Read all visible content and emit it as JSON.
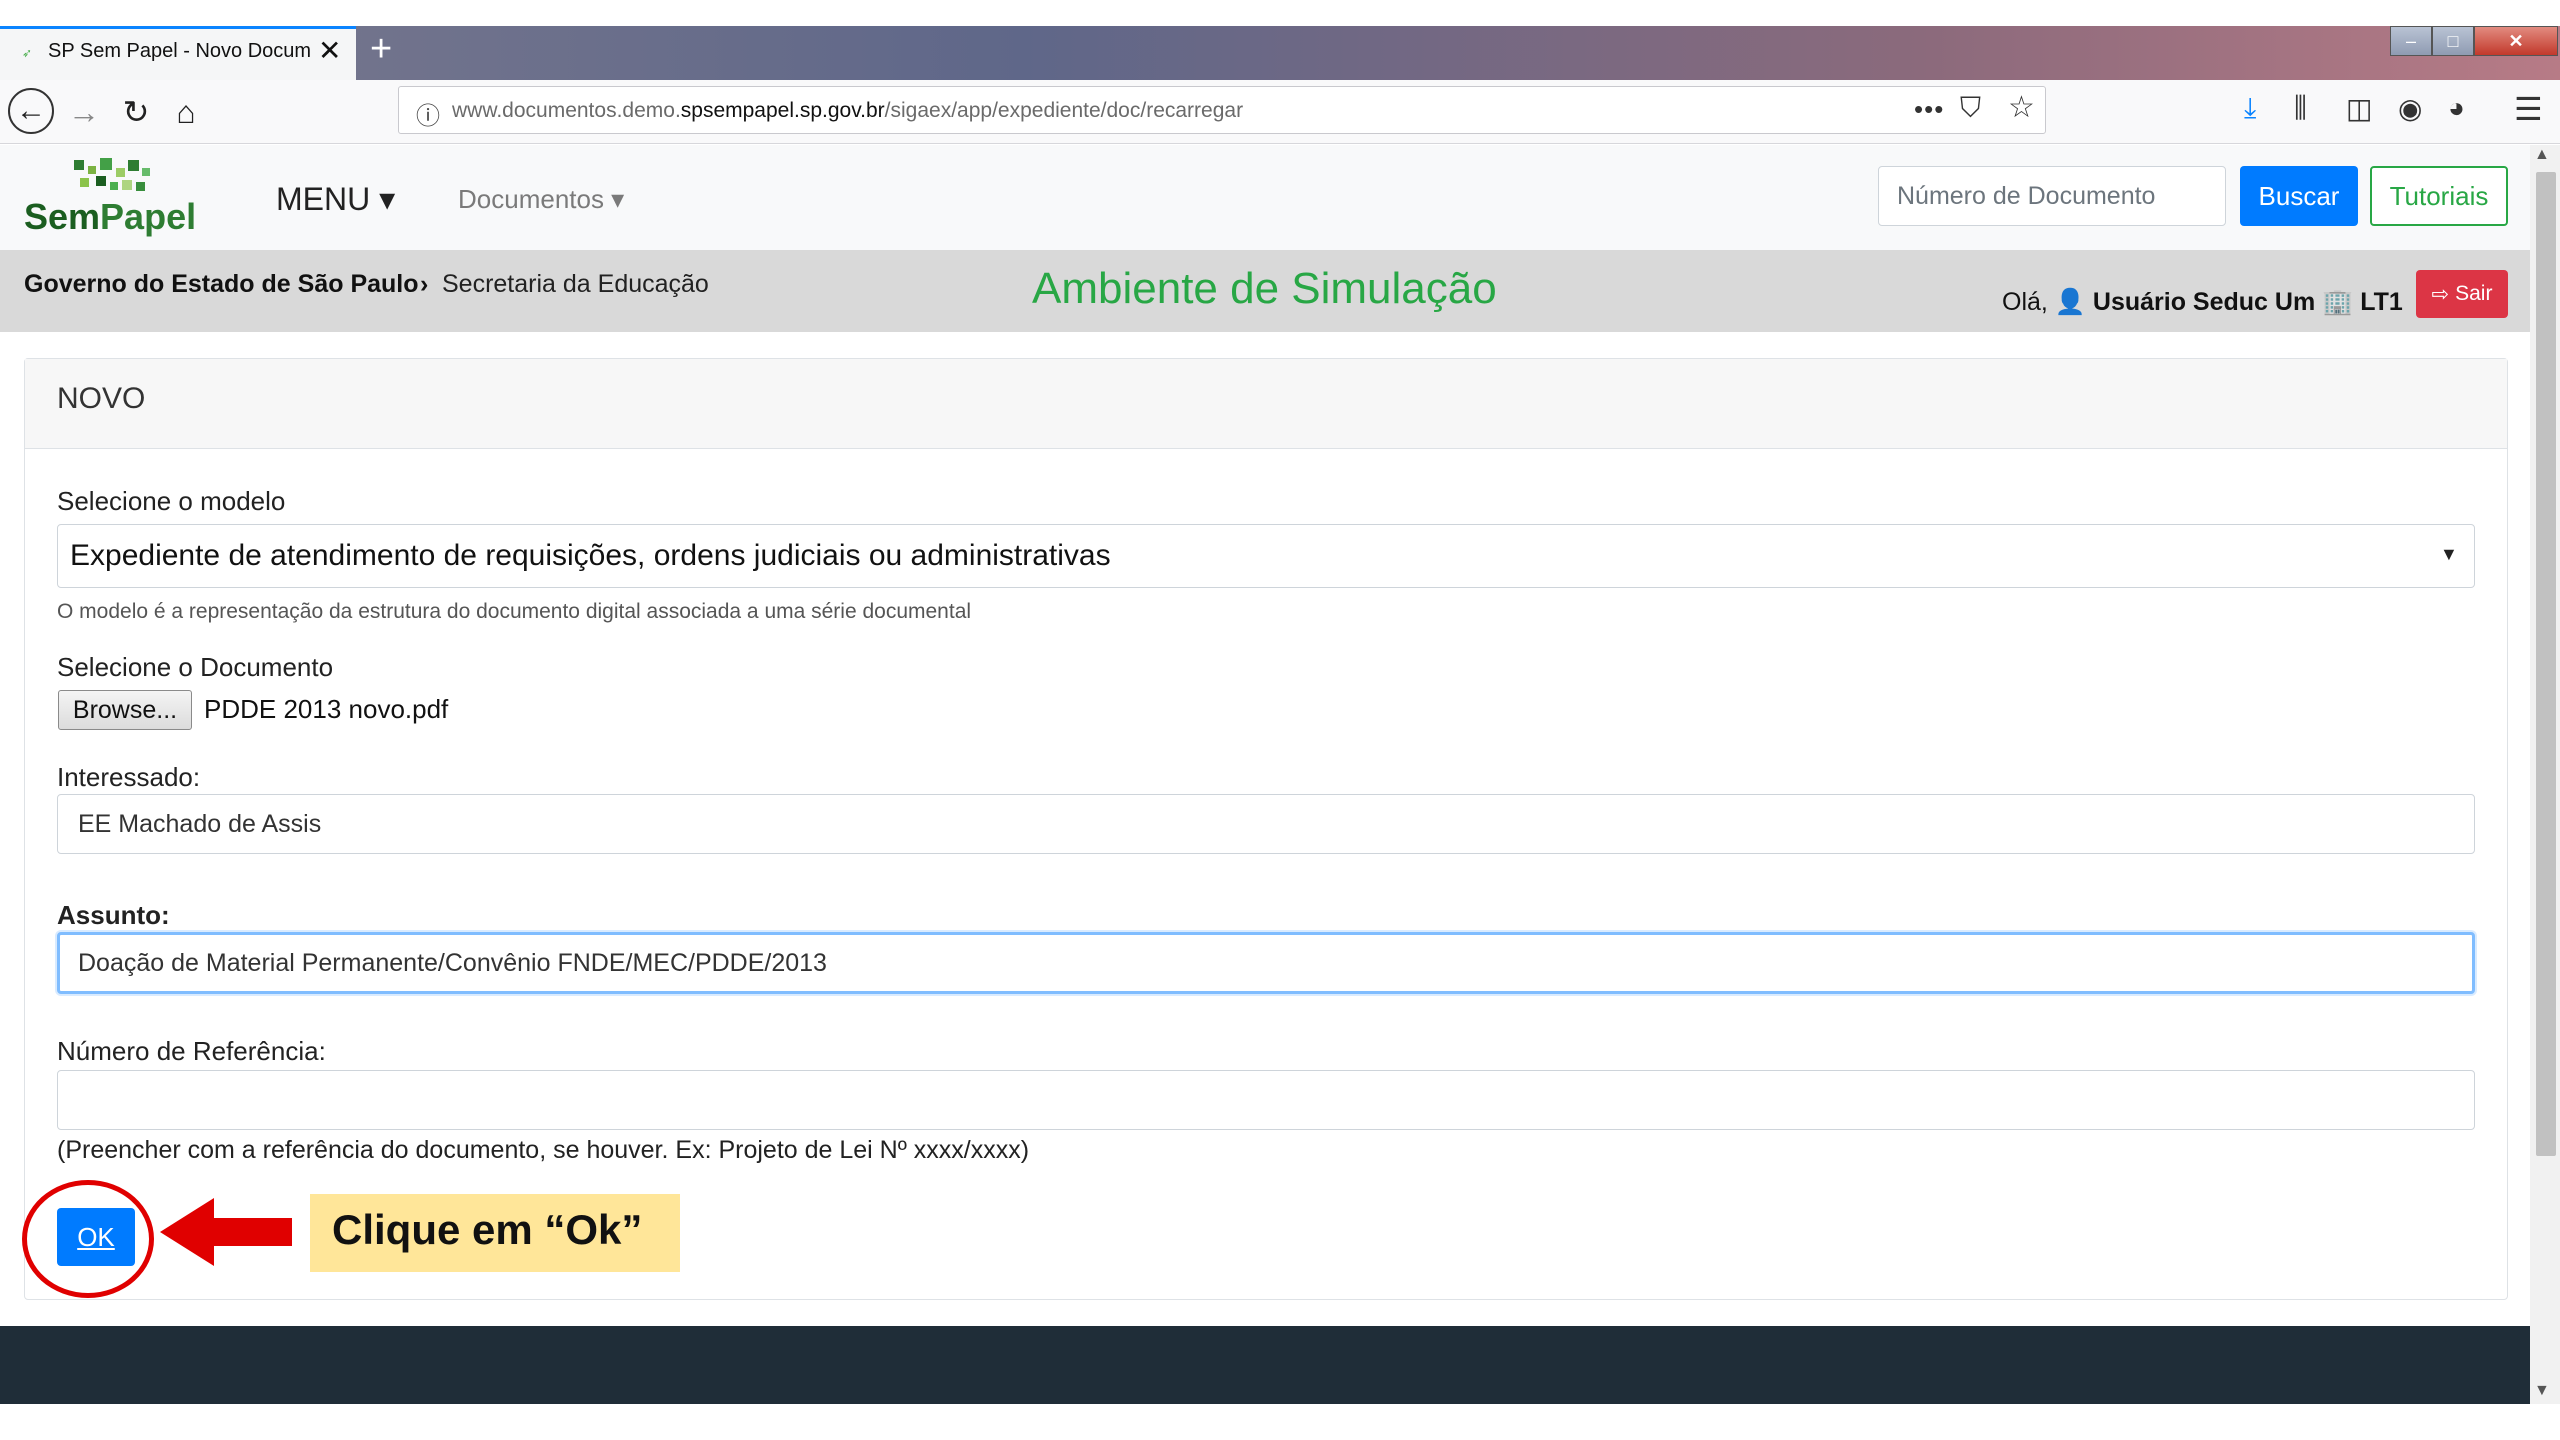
{
  "browser": {
    "tab_title": "SP Sem Papel - Novo Documen",
    "tab_close": "✕",
    "new_tab": "+",
    "url_plain": "www.documentos.demo.",
    "url_domain": "spsempapel.sp.gov.br",
    "url_path": "/sigaex/app/expediente/doc/recarregar",
    "controls": {
      "back": "←",
      "forward": "→",
      "reload": "↻",
      "home": "⌂",
      "page_actions": "•••",
      "pocket": "⛉",
      "star": "☆",
      "download": "⤓",
      "library": "⫼",
      "sidebar": "◫",
      "account": "◉",
      "extension": "◕",
      "menu": "☰"
    },
    "window": {
      "minimize": "–",
      "maximize": "□",
      "close": "✕"
    }
  },
  "header": {
    "logo": {
      "word1": "Sem",
      "word2": "Papel"
    },
    "menu_label": "MENU ▾",
    "docs_label": "Documentos ▾",
    "search_placeholder": "Número de Documento",
    "search_button": "Buscar",
    "tutorials_button": "Tutoriais"
  },
  "subbar": {
    "breadcrumb_gov": "Governo do Estado de São Paulo",
    "breadcrumb_sep": "›",
    "breadcrumb_sec": "Secretaria da Educação",
    "env_title": "Ambiente de Simulação",
    "greeting_prefix": "Olá, ",
    "user_name": "Usuário Seduc Um",
    "unit": "LT1",
    "logout": "Sair"
  },
  "form": {
    "card_title": "NOVO",
    "model_label": "Selecione o modelo",
    "model_value": "Expediente de atendimento de requisições, ordens judiciais ou administrativas",
    "model_help": "O modelo é a representação da estrutura do documento digital associada a uma série documental",
    "doc_label": "Selecione o Documento",
    "browse_button": "Browse...",
    "file_name": "PDDE 2013 novo.pdf",
    "interessado_label": "Interessado:",
    "interessado_value": "EE Machado de Assis",
    "assunto_label": "Assunto:",
    "assunto_value": "Doação de Material Permanente/Convênio FNDE/MEC/PDDE/2013",
    "ref_label": "Número de Referência:",
    "ref_value": "",
    "ref_help": "(Preencher com a referência do documento, se houver. Ex: Projeto de Lei Nº xxxx/xxxx)",
    "ok_button": "OK"
  },
  "annotation": {
    "callout": "Clique em “Ok”",
    "highlight_color": "#e00000",
    "callout_bg": "#ffe699"
  },
  "colors": {
    "primary": "#007bff",
    "success": "#28a745",
    "danger": "#dc3545",
    "footer": "#1f2d38"
  }
}
